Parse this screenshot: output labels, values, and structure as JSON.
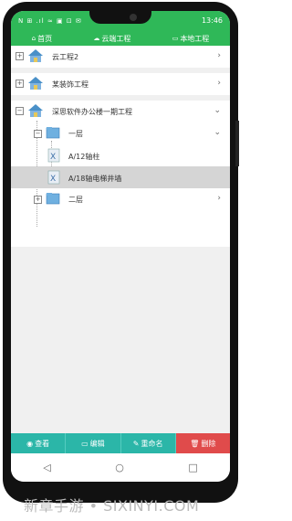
{
  "statusbar": {
    "left_icons": "N ⊞ .ıl ≈ ▣ ⊡ ✉",
    "time": "13:46"
  },
  "tabs": [
    {
      "icon": "home-icon",
      "label": "首页"
    },
    {
      "icon": "cloud-icon",
      "label": "云端工程"
    },
    {
      "icon": "folder-icon",
      "label": "本地工程"
    }
  ],
  "tree": {
    "p1": {
      "label": "云工程2"
    },
    "p2": {
      "label": "某装饰工程"
    },
    "p3": {
      "label": "深思软件办公楼一期工程"
    },
    "floor1": {
      "label": "一层"
    },
    "file1": {
      "label": "A/12轴柱"
    },
    "file2": {
      "label": "A/18轴电梯井墙"
    },
    "floor2": {
      "label": "二层"
    }
  },
  "actions": {
    "view": "查看",
    "edit": "编辑",
    "rename": "重命名",
    "delete": "删除"
  },
  "colors": {
    "green": "#2fb858",
    "teal": "#2bb6a8",
    "red": "#e04b4b"
  },
  "watermark": "新章手游 • SIXINYI.COM"
}
